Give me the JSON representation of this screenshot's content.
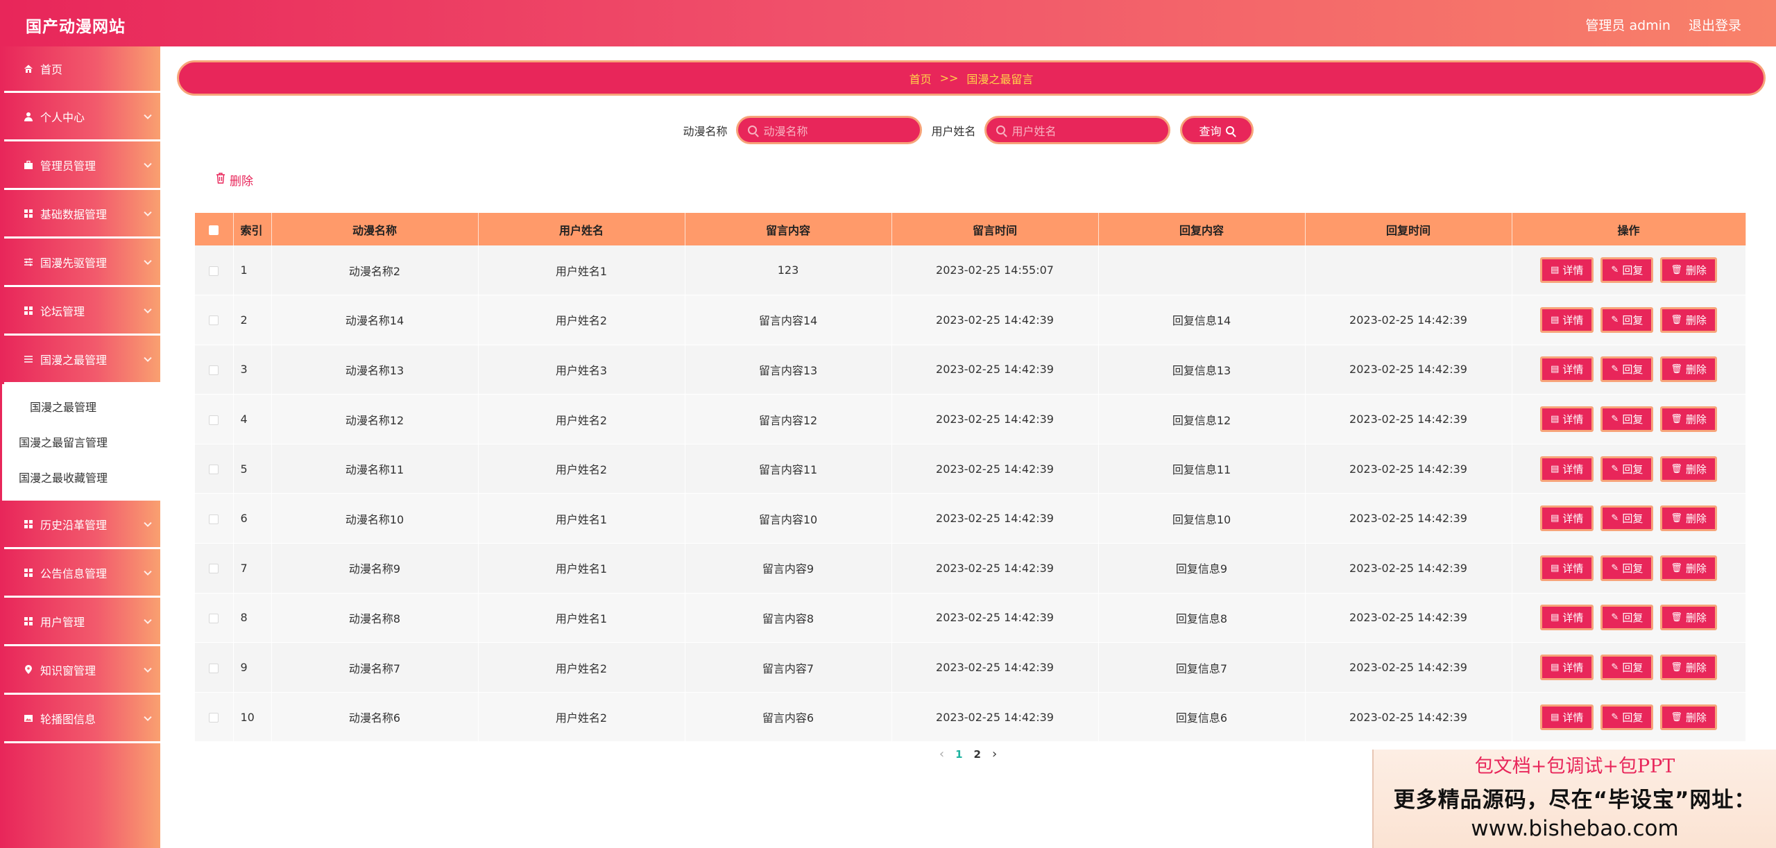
{
  "header": {
    "brand": "国产动漫网站",
    "admin_label": "管理员 admin",
    "logout_label": "退出登录"
  },
  "sidebar": {
    "items": [
      {
        "label": "首页",
        "icon": "home-icon"
      },
      {
        "label": "个人中心",
        "icon": "user-icon"
      },
      {
        "label": "管理员管理",
        "icon": "briefcase-icon"
      },
      {
        "label": "基础数据管理",
        "icon": "grid-icon"
      },
      {
        "label": "国漫先驱管理",
        "icon": "sliders-icon"
      },
      {
        "label": "论坛管理",
        "icon": "grid-icon"
      },
      {
        "label": "国漫之最管理",
        "icon": "list-icon"
      },
      {
        "label": "历史沿革管理",
        "icon": "grid-icon"
      },
      {
        "label": "公告信息管理",
        "icon": "grid-icon"
      },
      {
        "label": "用户管理",
        "icon": "grid-icon"
      },
      {
        "label": "知识窗管理",
        "icon": "location-icon"
      },
      {
        "label": "轮播图信息",
        "icon": "picture-icon"
      }
    ],
    "submenu": [
      {
        "label": "国漫之最管理"
      },
      {
        "label": "国漫之最留言管理"
      },
      {
        "label": "国漫之最收藏管理"
      }
    ]
  },
  "breadcrumb": {
    "home": "首页",
    "separator": ">>",
    "current": "国漫之最留言"
  },
  "search": {
    "anime_label": "动漫名称",
    "anime_placeholder": "动漫名称",
    "user_label": "用户姓名",
    "user_placeholder": "用户姓名",
    "query_label": "查询"
  },
  "toolbar": {
    "delete_label": "删除"
  },
  "table": {
    "columns": [
      "索引",
      "动漫名称",
      "用户姓名",
      "留言内容",
      "留言时间",
      "回复内容",
      "回复时间",
      "操作"
    ],
    "rows": [
      {
        "idx": "1",
        "anime": "动漫名称2",
        "user": "用户姓名1",
        "content": "123",
        "time": "2023-02-25 14:55:07",
        "reply": "",
        "reply_time": ""
      },
      {
        "idx": "2",
        "anime": "动漫名称14",
        "user": "用户姓名2",
        "content": "留言内容14",
        "time": "2023-02-25 14:42:39",
        "reply": "回复信息14",
        "reply_time": "2023-02-25 14:42:39"
      },
      {
        "idx": "3",
        "anime": "动漫名称13",
        "user": "用户姓名3",
        "content": "留言内容13",
        "time": "2023-02-25 14:42:39",
        "reply": "回复信息13",
        "reply_time": "2023-02-25 14:42:39"
      },
      {
        "idx": "4",
        "anime": "动漫名称12",
        "user": "用户姓名2",
        "content": "留言内容12",
        "time": "2023-02-25 14:42:39",
        "reply": "回复信息12",
        "reply_time": "2023-02-25 14:42:39"
      },
      {
        "idx": "5",
        "anime": "动漫名称11",
        "user": "用户姓名2",
        "content": "留言内容11",
        "time": "2023-02-25 14:42:39",
        "reply": "回复信息11",
        "reply_time": "2023-02-25 14:42:39"
      },
      {
        "idx": "6",
        "anime": "动漫名称10",
        "user": "用户姓名1",
        "content": "留言内容10",
        "time": "2023-02-25 14:42:39",
        "reply": "回复信息10",
        "reply_time": "2023-02-25 14:42:39"
      },
      {
        "idx": "7",
        "anime": "动漫名称9",
        "user": "用户姓名1",
        "content": "留言内容9",
        "time": "2023-02-25 14:42:39",
        "reply": "回复信息9",
        "reply_time": "2023-02-25 14:42:39"
      },
      {
        "idx": "8",
        "anime": "动漫名称8",
        "user": "用户姓名1",
        "content": "留言内容8",
        "time": "2023-02-25 14:42:39",
        "reply": "回复信息8",
        "reply_time": "2023-02-25 14:42:39"
      },
      {
        "idx": "9",
        "anime": "动漫名称7",
        "user": "用户姓名2",
        "content": "留言内容7",
        "time": "2023-02-25 14:42:39",
        "reply": "回复信息7",
        "reply_time": "2023-02-25 14:42:39"
      },
      {
        "idx": "10",
        "anime": "动漫名称6",
        "user": "用户姓名2",
        "content": "留言内容6",
        "time": "2023-02-25 14:42:39",
        "reply": "回复信息6",
        "reply_time": "2023-02-25 14:42:39"
      }
    ],
    "actions": {
      "detail": "详情",
      "reply": "回复",
      "delete": "删除"
    }
  },
  "pagination": {
    "pages": [
      "1",
      "2"
    ],
    "current": "1"
  },
  "watermark": {
    "line1": "包文档+包调试+包PPT",
    "line2": "更多精品源码，尽在“毕设宝”网址：",
    "line3": "www.bishebao.com"
  },
  "colors": {
    "primary": "#e8265a",
    "accent_border": "#f7a47a",
    "table_header": "#ff9a6a",
    "breadcrumb_text": "#ffd24a"
  }
}
